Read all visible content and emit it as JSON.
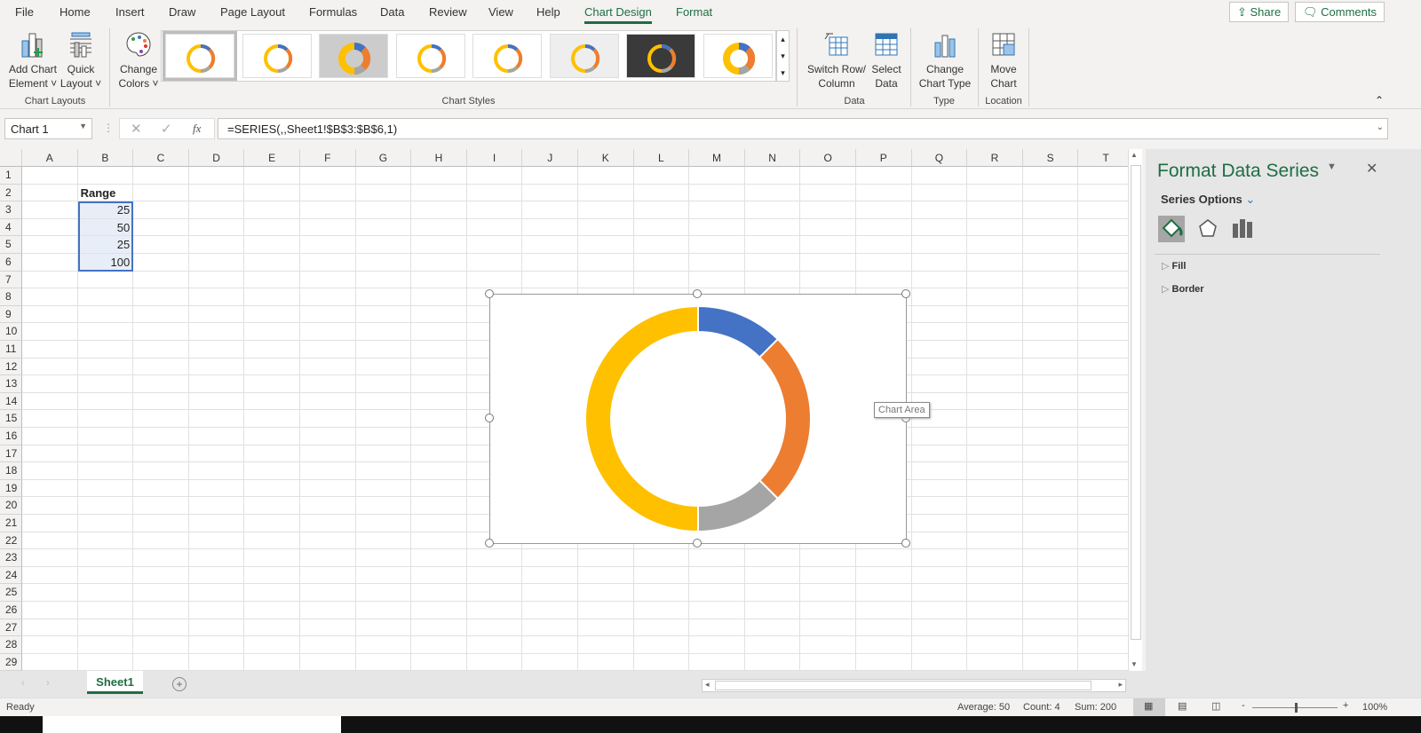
{
  "ribbon_tabs": [
    "File",
    "Home",
    "Insert",
    "Draw",
    "Page Layout",
    "Formulas",
    "Data",
    "Review",
    "View",
    "Help",
    "Chart Design",
    "Format"
  ],
  "active_tab": "Chart Design",
  "share": "Share",
  "comments": "Comments",
  "ribbon": {
    "add_chart_element": [
      "Add Chart",
      "Element ˅"
    ],
    "quick_layout": [
      "Quick",
      "Layout ˅"
    ],
    "change_colors": [
      "Change",
      "Colors ˅"
    ],
    "switch_row_column": [
      "Switch Row/",
      "Column"
    ],
    "select_data": [
      "Select",
      "Data"
    ],
    "change_chart_type": [
      "Change",
      "Chart Type"
    ],
    "move_chart": [
      "Move",
      "Chart"
    ],
    "groups": {
      "chart_layouts": "Chart Layouts",
      "chart_styles": "Chart Styles",
      "data": "Data",
      "type": "Type",
      "location": "Location"
    }
  },
  "formula_bar": {
    "name_box": "Chart 1",
    "fx": "fx",
    "formula": "=SERIES(,,Sheet1!$B$3:$B$6,1)"
  },
  "columns": [
    "A",
    "B",
    "C",
    "D",
    "E",
    "F",
    "G",
    "H",
    "I",
    "J",
    "K",
    "L",
    "M",
    "N",
    "O",
    "P",
    "Q",
    "R",
    "S",
    "T"
  ],
  "rows": 29,
  "cells": {
    "B2": "Range",
    "B3": "25",
    "B4": "50",
    "B5": "25",
    "B6": "100"
  },
  "chart_data": {
    "type": "donut",
    "values": [
      25,
      50,
      25,
      100
    ],
    "colors": [
      "#4472c4",
      "#ed7d31",
      "#a5a5a5",
      "#ffc000"
    ],
    "tooltip": "Chart Area"
  },
  "pane": {
    "title": "Format Data Series",
    "series_options": "Series Options",
    "sections": [
      "Fill",
      "Border"
    ],
    "icons": [
      "fill-line-icon",
      "effects-icon",
      "series-options-icon"
    ]
  },
  "sheet_tab": "Sheet1",
  "status": {
    "ready": "Ready",
    "average": "Average: 50",
    "count": "Count: 4",
    "sum": "Sum: 200",
    "zoom": "100%"
  }
}
